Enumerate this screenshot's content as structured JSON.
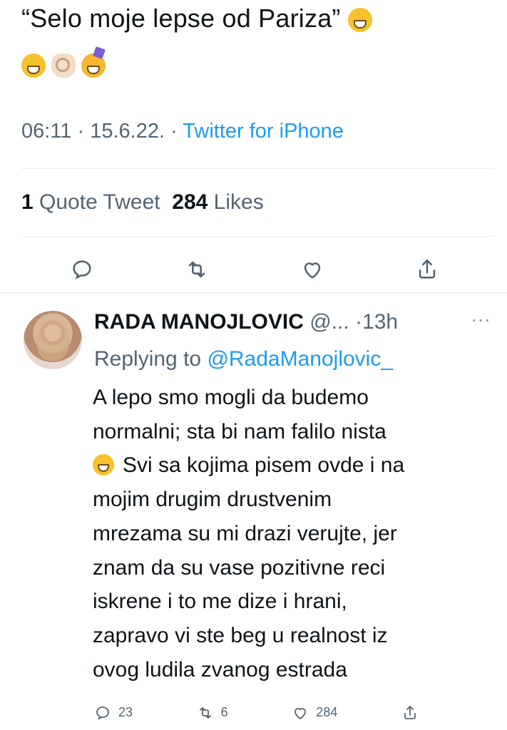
{
  "tweet": {
    "text": "“Selo moje lepse od Pariza”",
    "emojis": [
      "rolling-on-floor-laughing-emoji",
      "grinning-face-emoji",
      "ok-hand-emoji",
      "partying-face-emoji"
    ],
    "meta": {
      "time": "06:11",
      "separator1": " · ",
      "date": "15.6.22.",
      "separator2": " · ",
      "source": "Twitter for iPhone"
    },
    "stats": {
      "quote_count": "1",
      "quote_label": "Quote Tweet",
      "likes_count": "284",
      "likes_label": "Likes"
    },
    "actions": [
      "reply-icon",
      "retweet-icon",
      "like-icon",
      "share-icon"
    ]
  },
  "reply": {
    "name": "RADA MANOJLOVIC",
    "handle": "@...",
    "time": "·13h",
    "more": "···",
    "replying_prefix": "Replying to ",
    "replying_to": "@RadaManojlovic_",
    "lines": [
      "A lepo smo mogli da budemo",
      "normalni; sta bi nam falilo nista",
      "Svi sa kojima pisem ovde i na",
      "mojim drugim drustvenim",
      "mrezama su mi drazi verujte, jer",
      "znam da su vase pozitivne reci",
      "iskrene i to me dize i hrani,",
      "zapravo vi ste beg u realnost iz",
      "ovog ludila zvanog estrada"
    ],
    "metrics": {
      "replies": "23",
      "retweets": "6",
      "likes": "284"
    }
  },
  "colors": {
    "accent": "#1d9bf0",
    "text": "#0f1419",
    "muted": "#536471",
    "divider": "#e6ecf0"
  }
}
